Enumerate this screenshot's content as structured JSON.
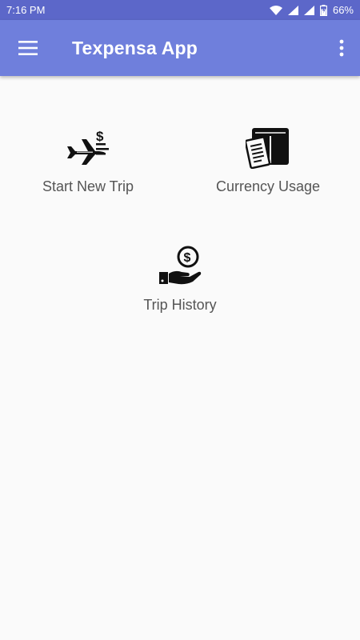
{
  "status_bar": {
    "time": "7:16 PM",
    "battery_percent": "66%",
    "icons": [
      "wifi-icon",
      "signal-icon",
      "signal-icon",
      "battery-icon"
    ]
  },
  "app_bar": {
    "title": "Texpensa App",
    "menu_icon": "hamburger-menu-icon",
    "overflow_icon": "more-vert-icon",
    "background": "#6f7fdc",
    "status_background": "#5c67c9"
  },
  "main": {
    "tiles": [
      {
        "label": "Start New Trip",
        "icon": "airplane-dollar-icon"
      },
      {
        "label": "Currency Usage",
        "icon": "receipts-icon"
      },
      {
        "label": "Trip History",
        "icon": "hand-coin-icon"
      }
    ]
  }
}
